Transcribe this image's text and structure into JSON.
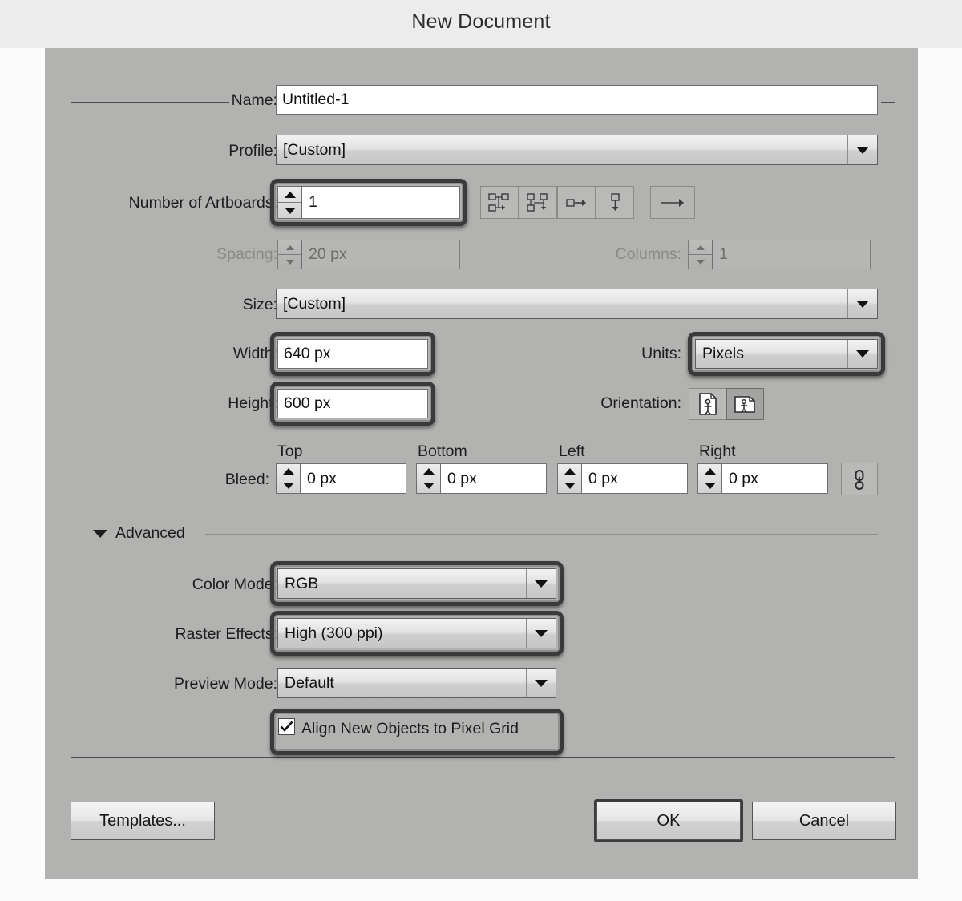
{
  "window": {
    "title": "New Document"
  },
  "fields": {
    "name": {
      "label": "Name:",
      "value": "Untitled-1"
    },
    "profile": {
      "label": "Profile:",
      "value": "[Custom]"
    },
    "num_artboards": {
      "label": "Number of Artboards:",
      "value": "1"
    },
    "spacing": {
      "label": "Spacing:",
      "value": "20 px"
    },
    "columns": {
      "label": "Columns:",
      "value": "1"
    },
    "size": {
      "label": "Size:",
      "value": "[Custom]"
    },
    "width": {
      "label": "Width:",
      "value": "640 px"
    },
    "height": {
      "label": "Height:",
      "value": "600 px"
    },
    "units": {
      "label": "Units:",
      "value": "Pixels"
    },
    "orientation": {
      "label": "Orientation:"
    },
    "bleed": {
      "label": "Bleed:",
      "top": {
        "label": "Top",
        "value": "0 px"
      },
      "bottom": {
        "label": "Bottom",
        "value": "0 px"
      },
      "left": {
        "label": "Left",
        "value": "0 px"
      },
      "right": {
        "label": "Right",
        "value": "0 px"
      }
    }
  },
  "advanced": {
    "label": "Advanced",
    "color_mode": {
      "label": "Color Mode:",
      "value": "RGB"
    },
    "raster_effects": {
      "label": "Raster Effects:",
      "value": "High (300 ppi)"
    },
    "preview_mode": {
      "label": "Preview Mode:",
      "value": "Default"
    },
    "align_pixel_grid": {
      "label": "Align New Objects to Pixel Grid",
      "checked": true
    }
  },
  "buttons": {
    "templates": "Templates...",
    "ok": "OK",
    "cancel": "Cancel"
  },
  "icons": {
    "artboard_grid_by_row": "artboard-grid-by-row-icon",
    "artboard_grid_by_column": "artboard-grid-by-column-icon",
    "artboard_arrange_by_row": "artboard-arrange-by-row-icon",
    "artboard_arrange_by_column": "artboard-arrange-by-column-icon",
    "artboard_direction": "artboard-direction-arrow-icon",
    "orientation_portrait": "orientation-portrait-icon",
    "orientation_landscape": "orientation-landscape-icon",
    "bleed_link": "bleed-link-chain-icon"
  },
  "colors": {
    "dialog_bg": "#b2b2b0",
    "titlebar_bg": "#ececec",
    "page_bg": "#fbfbfb",
    "highlight_ring": "#3a3a3a",
    "text": "#1d1d1d",
    "disabled_text": "#8a8a88"
  }
}
